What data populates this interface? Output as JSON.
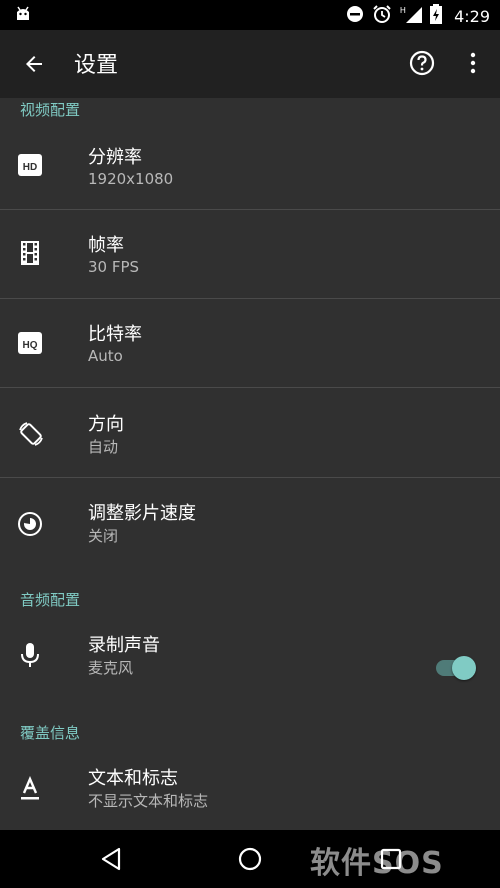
{
  "statusbar": {
    "time": "4:29",
    "signal_label": "H"
  },
  "appbar": {
    "title": "设置"
  },
  "sections": {
    "video": "视频配置",
    "audio": "音频配置",
    "overlay": "覆盖信息"
  },
  "video_items": [
    {
      "title": "分辨率",
      "value": "1920x1080",
      "icon": "hd-icon"
    },
    {
      "title": "帧率",
      "value": "30 FPS",
      "icon": "film-icon"
    },
    {
      "title": "比特率",
      "value": "Auto",
      "icon": "hq-icon"
    },
    {
      "title": "方向",
      "value": "自动",
      "icon": "screen-rotation-icon"
    },
    {
      "title": "调整影片速度",
      "value": "关闭",
      "icon": "speed-icon"
    }
  ],
  "audio_item": {
    "title": "录制声音",
    "value": "麦克风",
    "icon": "microphone-icon",
    "enabled": true
  },
  "overlay_item": {
    "title": "文本和标志",
    "value": "不显示文本和标志",
    "icon": "text-format-icon"
  },
  "watermark": "软件SOS",
  "colors": {
    "accent": "#80cbc4",
    "background": "#303030",
    "appbar": "#212121"
  }
}
